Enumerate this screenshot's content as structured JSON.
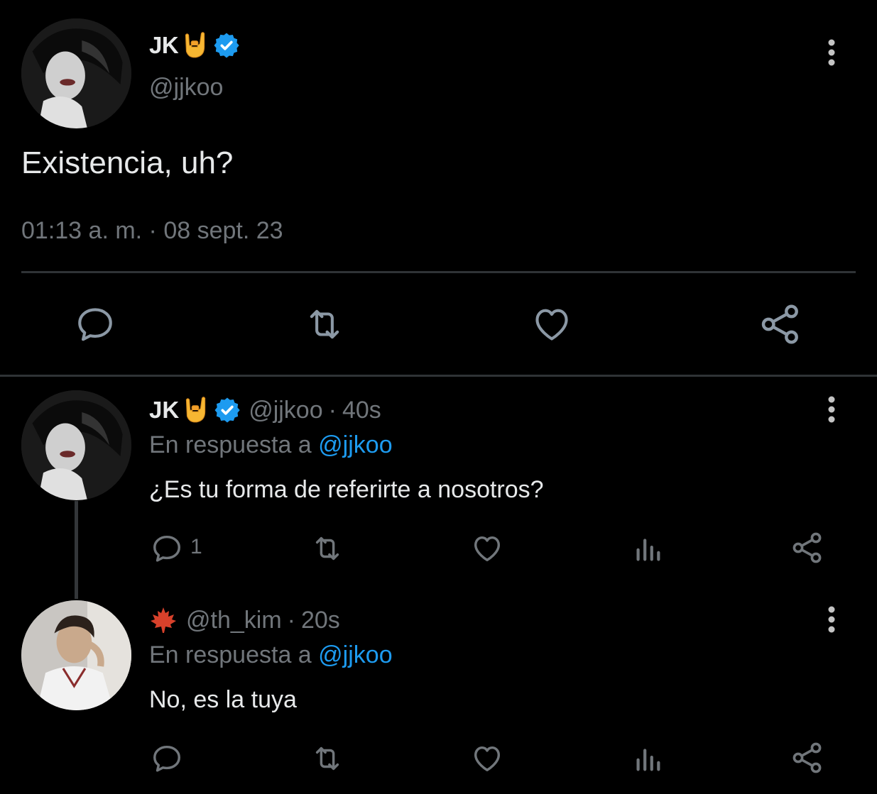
{
  "main_tweet": {
    "display_name": "JK",
    "handle": "@jjkoo",
    "text": "Existencia, uh?",
    "timestamp": "01:13 a. m. · 08 sept. 23"
  },
  "replies": [
    {
      "display_name": "JK",
      "handle": "@jjkoo",
      "separator": "·",
      "age": "40s",
      "reply_prefix": "En respuesta a",
      "reply_mention": "@jjkoo",
      "text": "¿Es tu forma de referirte a nosotros?",
      "reply_count": "1"
    },
    {
      "display_name": "",
      "handle": "@th_kim",
      "separator": "·",
      "age": "20s",
      "reply_prefix": "En respuesta a",
      "reply_mention": "@jjkoo",
      "text": "No, es la tuya",
      "reply_count": ""
    }
  ],
  "icons": {
    "verified": "verified-badge-icon",
    "hand": "sign-of-horns-emoji",
    "maple": "maple-leaf-emoji",
    "reply": "reply-icon",
    "retweet": "retweet-icon",
    "like": "heart-icon",
    "share": "share-icon",
    "views": "analytics-icon",
    "more": "more-vertical-icon"
  },
  "colors": {
    "background": "#000000",
    "text": "#e7e9ea",
    "secondary": "#71767b",
    "accent": "#1d9bf0",
    "divider": "#2f3336",
    "verified": "#1d9bf0"
  }
}
